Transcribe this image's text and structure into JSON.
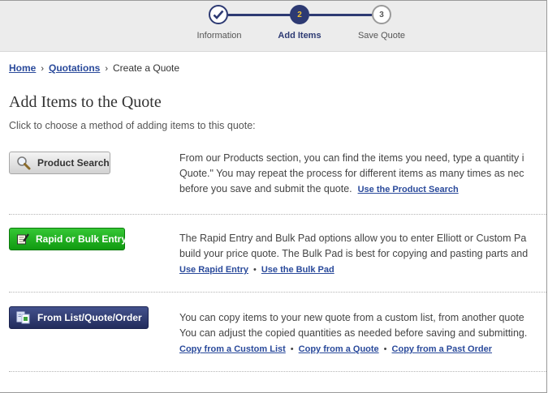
{
  "progress": {
    "steps": [
      {
        "number": "",
        "label": "Information"
      },
      {
        "number": "2",
        "label": "Add Items"
      },
      {
        "number": "3",
        "label": "Save Quote"
      }
    ]
  },
  "breadcrumb": {
    "home": "Home",
    "quotations": "Quotations",
    "current": "Create a Quote",
    "sep": "›"
  },
  "page": {
    "title": "Add Items to the Quote",
    "subtitle": "Click to choose a method of adding items to this quote:"
  },
  "methods": {
    "search": {
      "button": "Product Search",
      "icon": "magnifier-icon",
      "lines": [
        "From our Products section, you can find the items you need, type a quantity i",
        "Quote.\" You may repeat the process for different items as many times as nec",
        "before you save and submit the quote."
      ],
      "link": "Use the Product Search"
    },
    "rapid": {
      "button": "Rapid or Bulk Entry",
      "icon": "notepad-pencil-icon",
      "lines": [
        "The Rapid Entry and Bulk Pad options allow you to enter Elliott or Custom Pa",
        "build your price quote. The Bulk Pad is best for copying and pasting parts and"
      ],
      "links": [
        "Use Rapid Entry",
        "Use the Bulk Pad"
      ]
    },
    "list": {
      "button": "From List/Quote/Order",
      "icon": "copy-documents-icon",
      "lines": [
        "You can copy items to your new quote from a custom list, from another quote",
        "You can adjust the copied quantities as needed before saving and submitting."
      ],
      "links": [
        "Copy from a Custom List",
        "Copy from a Quote",
        "Copy from a Past Order"
      ]
    }
  },
  "bullet": "•",
  "colors": {
    "primary": "#2d3a73",
    "active_number": "#f2c230",
    "green": "#19a719",
    "link": "#2a4a9b"
  }
}
